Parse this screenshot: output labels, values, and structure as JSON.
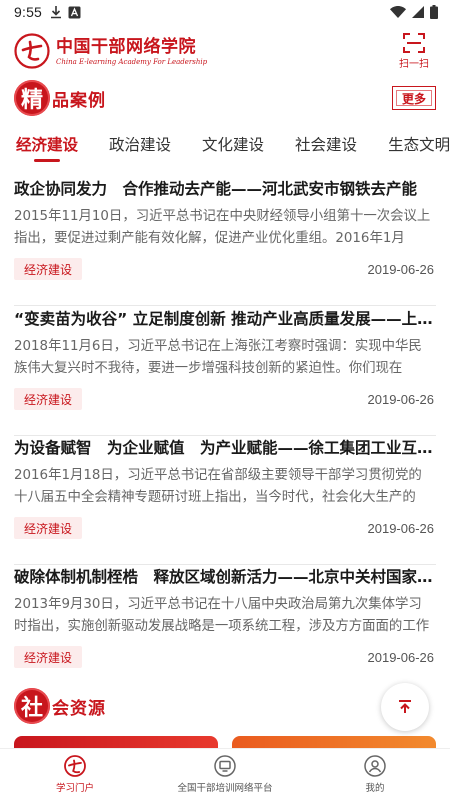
{
  "status_bar": {
    "time": "9:55"
  },
  "header": {
    "title": "中国干部网络学院",
    "subtitle": "China E-learning Academy For Leadership",
    "scan_label": "扫一扫"
  },
  "featured": {
    "seal_char": "精",
    "title": "品案例",
    "more_label": "更多"
  },
  "tabs": [
    {
      "label": "经济建设",
      "active": true
    },
    {
      "label": "政治建设",
      "active": false
    },
    {
      "label": "文化建设",
      "active": false
    },
    {
      "label": "社会建设",
      "active": false
    },
    {
      "label": "生态文明",
      "active": false
    }
  ],
  "articles": [
    {
      "title": "政企协同发力　合作推动去产能——河北武安市钢铁去产能",
      "summary": "2015年11月10日，习近平总书记在中央财经领导小组第十一次会议上指出，要促进过剩产能有效化解，促进产业优化重组。2016年1月",
      "tag": "经济建设",
      "date": "2019-06-26"
    },
    {
      "title": "“变卖苗为收谷” 立足制度创新 推动产业高质量发展——上海张江",
      "summary": "2018年11月6日，习近平总书记在上海张江考察时强调：实现中华民族伟大复兴时不我待，要进一步增强科技创新的紧迫性。你们现在",
      "tag": "经济建设",
      "date": "2019-06-26"
    },
    {
      "title": "为设备赋智　为企业赋值　为产业赋能——徐工集团工业互联网",
      "summary": "2016年1月18日，习近平总书记在省部级主要领导干部学习贯彻党的十八届五中全会精神专题研讨班上指出，当今时代，社会化大生产的",
      "tag": "经济建设",
      "date": "2019-06-26"
    },
    {
      "title": "破除体制机制桎梏　释放区域创新活力——北京中关村国家自主",
      "summary": "2013年9月30日，习近平总书记在十八届中央政治局第九次集体学习时指出，实施创新驱动发展战略是一项系统工程，涉及方方面面的工作",
      "tag": "经济建设",
      "date": "2019-06-26"
    }
  ],
  "social": {
    "seal_char": "社",
    "title": "会资源"
  },
  "bottom_nav": [
    {
      "label": "学习门户",
      "icon": "portal-icon",
      "active": true
    },
    {
      "label": "全国干部培训网络平台",
      "icon": "monitor-icon",
      "active": false
    },
    {
      "label": "我的",
      "icon": "user-icon",
      "active": false
    }
  ],
  "colors": {
    "brand_red": "#c8161d",
    "tag_bg": "#fcecec"
  }
}
